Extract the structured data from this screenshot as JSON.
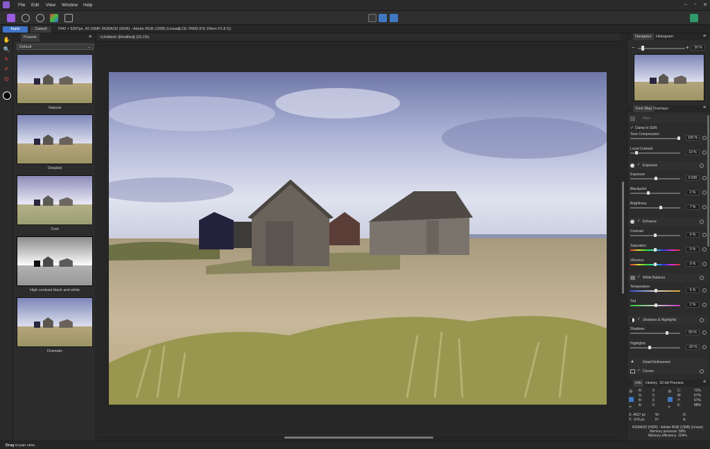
{
  "menubar": {
    "items": [
      "File",
      "Edit",
      "View",
      "Window",
      "Help"
    ]
  },
  "contextbar": {
    "apply_label": "Apply",
    "cancel_label": "Cancel",
    "doc_info": "7942 × 5307px, 42.15MP, RGBA/32 (HDR) - Adobe RGB (1998) (Linear)",
    "camera": "ILCE-7RM3 (FE 20mm F1.8 G)"
  },
  "presets": {
    "tab_label": "Presets",
    "dropdown_value": "Default",
    "items": [
      {
        "label": "Natural",
        "style": "color"
      },
      {
        "label": "Detailed",
        "style": "color"
      },
      {
        "label": "Cool",
        "style": "cool"
      },
      {
        "label": "High contrast black and white",
        "style": "bw"
      },
      {
        "label": "Dramatic",
        "style": "color"
      }
    ]
  },
  "document": {
    "tab_title": "<Untitled> [Modified] (20.1%)"
  },
  "navigator": {
    "tabs": [
      "Navigator",
      "Histogram"
    ],
    "zoom_value": "20 %"
  },
  "tonemap": {
    "tabs": [
      "Tone Map",
      "Overlays"
    ],
    "main_label": "Main",
    "clamp_label": "Clamp to SDR",
    "tone_compression": {
      "label": "Tone Compression",
      "value": "100 %",
      "fraction": 1.0
    },
    "local_contrast": {
      "label": "Local Contrast",
      "value": "10 %",
      "fraction": 0.1
    },
    "exposure_section": "Exposure",
    "exposure": {
      "label": "Exposure",
      "value": "0.036",
      "fraction": 0.52
    },
    "blackpoint": {
      "label": "Blackpoint",
      "value": "2 %",
      "fraction": 0.35
    },
    "brightness": {
      "label": "Brightness",
      "value": "7 %",
      "fraction": 0.62
    },
    "enhance_section": "Enhance",
    "contrast": {
      "label": "Contrast",
      "value": "0 %",
      "fraction": 0.5
    },
    "saturation": {
      "label": "Saturation",
      "value": "0 %",
      "fraction": 0.5
    },
    "vibrance": {
      "label": "Vibrance",
      "value": "0 %",
      "fraction": 0.5
    },
    "wb_section": "White Balance",
    "temperature": {
      "label": "Temperature",
      "value": "5 %",
      "fraction": 0.52
    },
    "tint": {
      "label": "Tint",
      "value": "2 %",
      "fraction": 0.51
    },
    "sh_section": "Shadows & Highlights",
    "shadows": {
      "label": "Shadows",
      "value": "55 %",
      "fraction": 0.75
    },
    "highlights": {
      "label": "Highlights",
      "value": "-20 %",
      "fraction": 0.38
    },
    "detail_section": "Detail Refinement",
    "curves_section": "Curves"
  },
  "info": {
    "tabs": [
      "Info",
      "History",
      "32-bit Preview"
    ],
    "left_channels": [
      [
        "R:",
        "0"
      ],
      [
        "G:",
        "0"
      ],
      [
        "B:",
        "0"
      ],
      [
        "A:",
        "0"
      ]
    ],
    "right_channels": [
      [
        "C:",
        "72%"
      ],
      [
        "M:",
        "67%"
      ],
      [
        "Y:",
        "67%"
      ],
      [
        "K:",
        "88%"
      ]
    ],
    "x": "X: 4627 px",
    "y": "Y: -576 px",
    "w": "W:",
    "h": "H:",
    "d": "D:",
    "a": "A:",
    "colorspace": "RGBA/32 (HDR) - Adobe RGB (1998) (Linear)",
    "mem_pressure": "Memory pressure: 58%",
    "mem_efficiency": "Memory efficiency: 154%"
  },
  "status": {
    "bold": "Drag",
    "rest": "to pan view."
  }
}
